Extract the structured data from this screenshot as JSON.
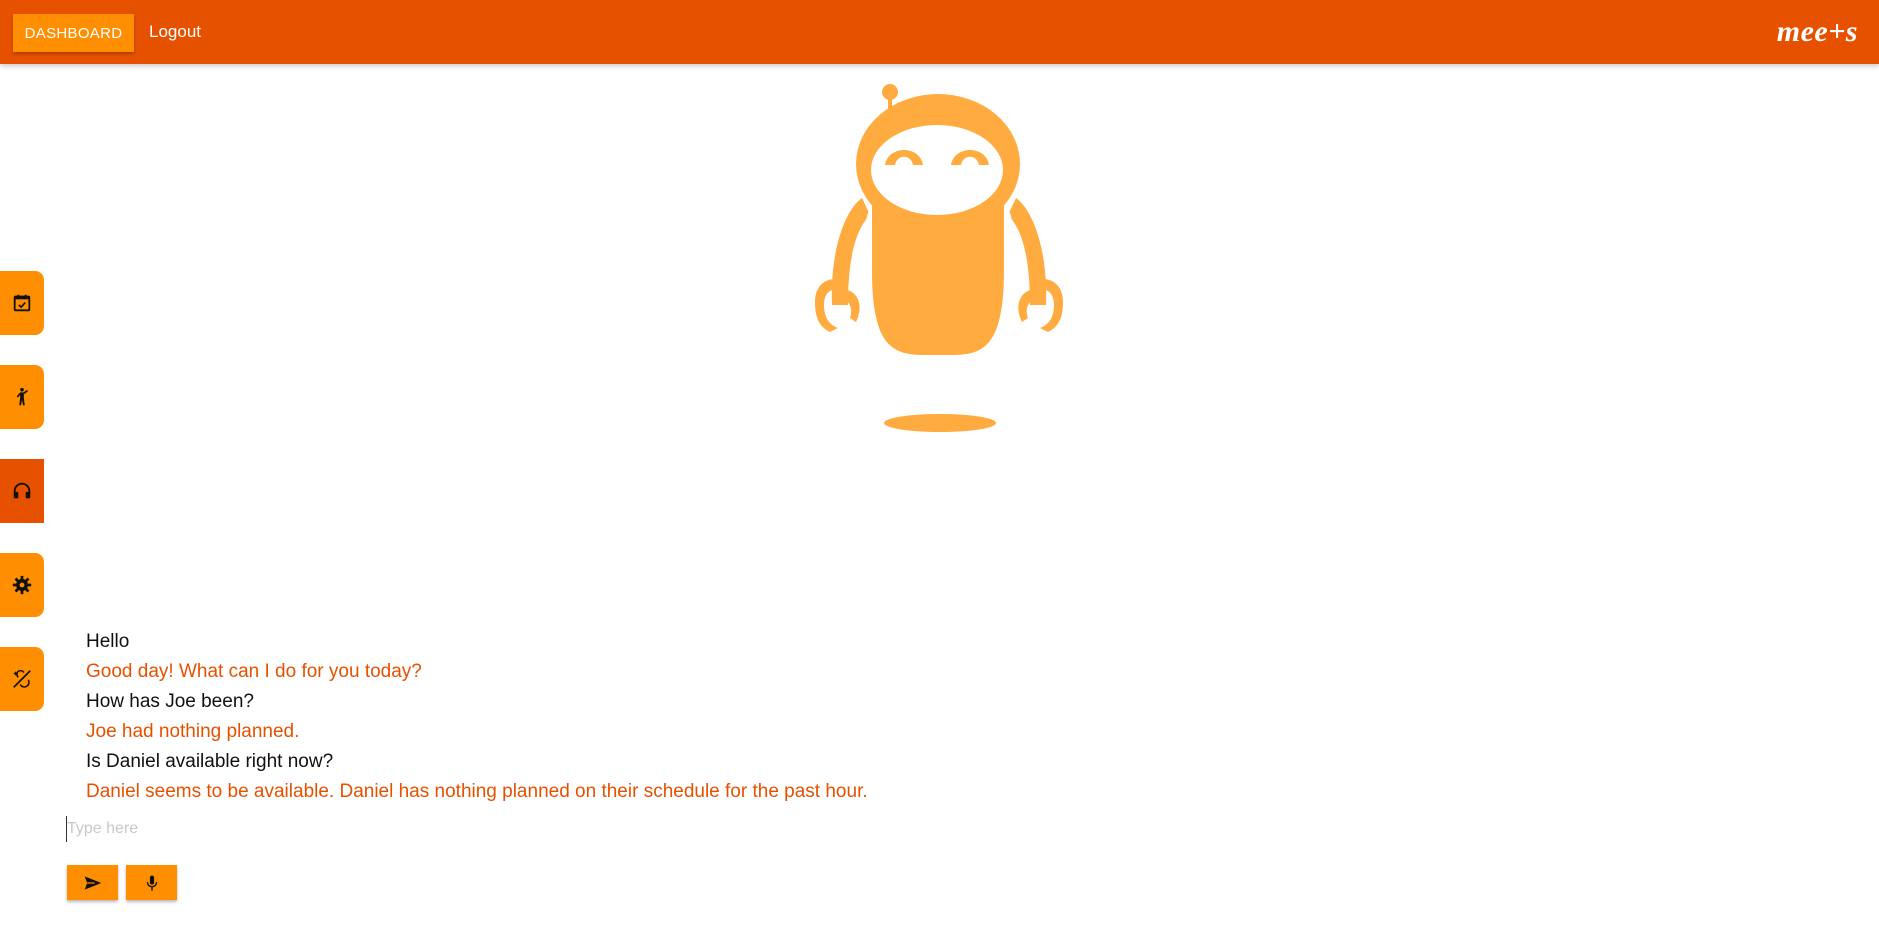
{
  "header": {
    "dashboard_label": "DASHBOARD",
    "logout_label": "Logout",
    "logo_text": "mee+s"
  },
  "sidebar": {
    "items": [
      {
        "icon": "calendar-check-icon",
        "active": false
      },
      {
        "icon": "walking-person-icon",
        "active": false
      },
      {
        "icon": "headset-icon",
        "active": true
      },
      {
        "icon": "gear-icon",
        "active": false
      },
      {
        "icon": "magic-wand-icon",
        "active": false
      }
    ]
  },
  "chat": {
    "messages": [
      {
        "from": "user",
        "text": "Hello"
      },
      {
        "from": "bot",
        "text": "Good day! What can I do for you today?"
      },
      {
        "from": "user",
        "text": "How has Joe been?"
      },
      {
        "from": "bot",
        "text": "Joe had nothing planned."
      },
      {
        "from": "user",
        "text": "Is Daniel available right now?"
      },
      {
        "from": "bot",
        "text": "Daniel seems to be available. Daniel has nothing planned on their schedule for the past hour."
      }
    ],
    "input_value": "",
    "input_placeholder": "Type here",
    "send_icon": "send-icon",
    "mic_icon": "microphone-icon"
  },
  "colors": {
    "header_bg": "#e65100",
    "accent": "#ff8f00",
    "robot": "#ffab40",
    "user_text": "#111111",
    "bot_text": "#e65100"
  }
}
